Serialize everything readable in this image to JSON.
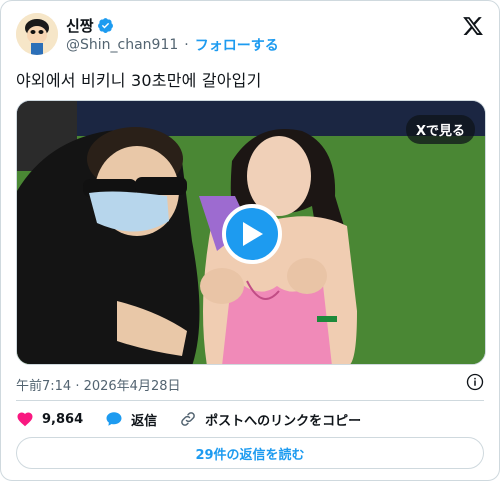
{
  "author": {
    "display_name": "신짱",
    "handle": "@Shin_chan911",
    "follow_label": "フォローする"
  },
  "tweet": {
    "text": "야외에서 비키니 30초만에 갈아입기",
    "timestamp": "午前7:14 · 2026年4月28日"
  },
  "media": {
    "view_on_x_label": "Xで見る"
  },
  "actions": {
    "like_count": "9,864",
    "reply_label": "返信",
    "copy_link_label": "ポストへのリンクをコピー"
  },
  "read_replies_label": "29件の返信を読む",
  "colors": {
    "accent": "#1d9bf0",
    "like": "#f91880",
    "text": "#0f1419",
    "muted": "#536471",
    "border": "#cfd9de"
  },
  "icons": [
    "verified-badge-icon",
    "x-logo-icon",
    "play-icon",
    "info-icon",
    "heart-icon",
    "reply-bubble-icon",
    "link-icon"
  ]
}
